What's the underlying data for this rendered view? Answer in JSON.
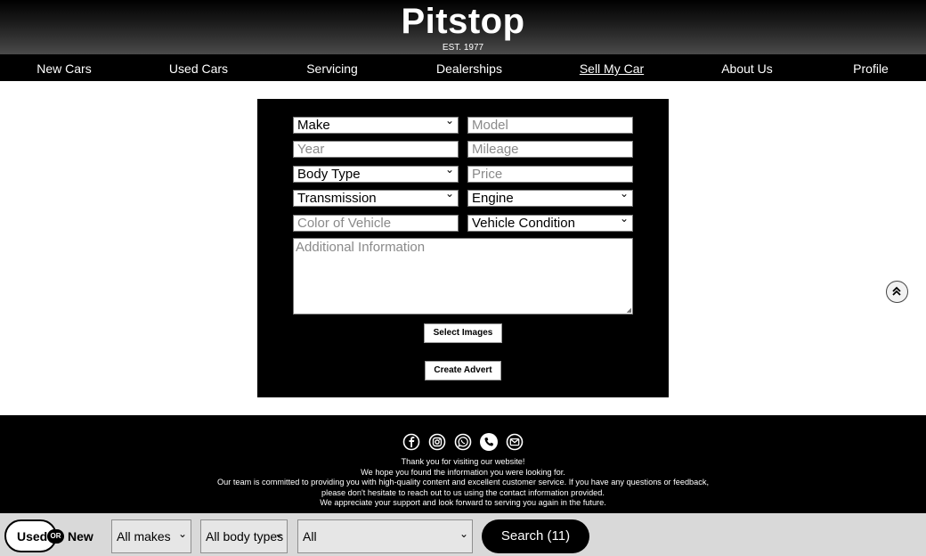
{
  "header": {
    "brand": "Pitstop",
    "est": "EST. 1977"
  },
  "nav": {
    "items": [
      {
        "label": "New Cars"
      },
      {
        "label": "Used Cars"
      },
      {
        "label": "Servicing"
      },
      {
        "label": "Dealerships"
      },
      {
        "label": "Sell My Car",
        "active": true
      },
      {
        "label": "About Us"
      },
      {
        "label": "Profile"
      }
    ]
  },
  "form": {
    "make": "Make",
    "model_placeholder": "Model",
    "year_placeholder": "Year",
    "mileage_placeholder": "Mileage",
    "body_type": "Body Type",
    "price_placeholder": "Price",
    "transmission": "Transmission",
    "engine": "Engine",
    "color_placeholder": "Color of Vehicle",
    "condition": "Vehicle Condition",
    "additional_placeholder": "Additional Information",
    "select_images_label": "Select Images",
    "create_advert_label": "Create Advert"
  },
  "footer": {
    "icons": [
      "facebook-icon",
      "instagram-icon",
      "whatsapp-icon",
      "phone-icon",
      "email-icon"
    ],
    "lines": [
      "Thank you for visiting our website!",
      "We hope you found the information you were looking for.",
      "Our team is committed to providing you with high-quality content and excellent customer service. If you have any questions or feedback,",
      "please don't hesitate to reach out to us using the contact information provided.",
      "We appreciate your support and look forward to serving you again in the future."
    ]
  },
  "search_bar": {
    "used_label": "Used",
    "or_label": "OR",
    "new_label": "New",
    "makes": "All makes",
    "body_types": "All body types",
    "all": "All",
    "search_label": "Search (11)"
  }
}
